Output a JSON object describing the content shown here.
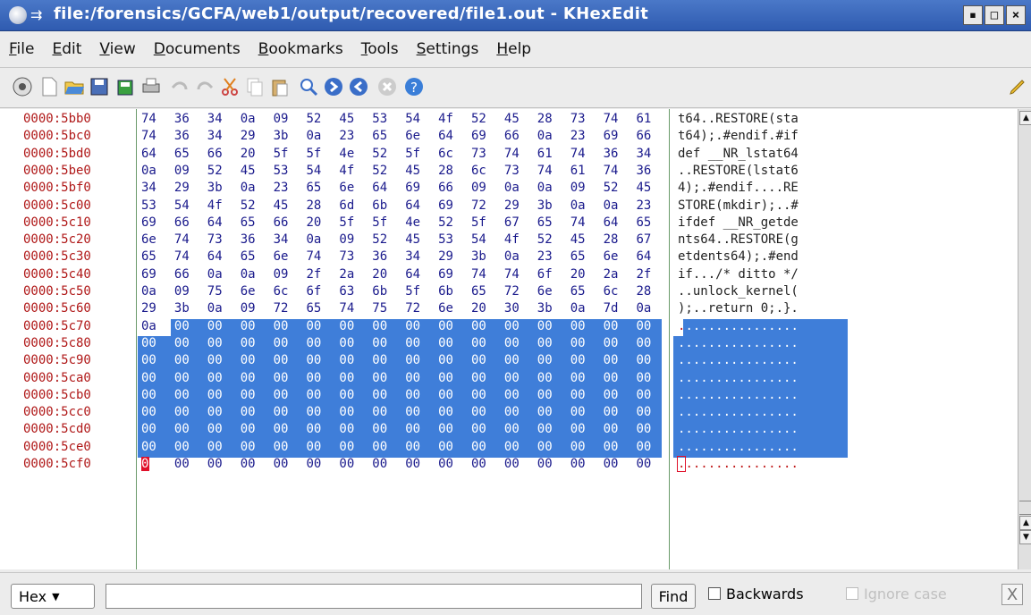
{
  "window": {
    "title": "file:/forensics/GCFA/web1/output/recovered/file1.out - KHexEdit",
    "buttons": [
      "▪",
      "□",
      "×"
    ]
  },
  "menu": [
    {
      "label": "File",
      "ul": "F"
    },
    {
      "label": "Edit",
      "ul": "E"
    },
    {
      "label": "View",
      "ul": "V"
    },
    {
      "label": "Documents",
      "ul": "D"
    },
    {
      "label": "Bookmarks",
      "ul": "B"
    },
    {
      "label": "Tools",
      "ul": "T"
    },
    {
      "label": "Settings",
      "ul": "S"
    },
    {
      "label": "Help",
      "ul": "H"
    }
  ],
  "toolbar_icons": [
    "app-icon",
    "new-file-icon",
    "open-folder-icon",
    "save-icon",
    "save-as-icon",
    "print-icon",
    "undo-icon",
    "redo-icon",
    "cut-icon",
    "copy-icon",
    "paste-icon",
    "find-icon",
    "forward-icon",
    "back-icon",
    "stop-icon",
    "help-icon",
    "edit-pencil-icon"
  ],
  "hex_rows": [
    {
      "offset": "0000:5bb0",
      "bytes": [
        "74",
        "36",
        "34",
        "0a",
        "09",
        "52",
        "45",
        "53",
        "54",
        "4f",
        "52",
        "45",
        "28",
        "73",
        "74",
        "61"
      ],
      "ascii": "t64..RESTORE(sta"
    },
    {
      "offset": "0000:5bc0",
      "bytes": [
        "74",
        "36",
        "34",
        "29",
        "3b",
        "0a",
        "23",
        "65",
        "6e",
        "64",
        "69",
        "66",
        "0a",
        "23",
        "69",
        "66"
      ],
      "ascii": "t64);.#endif.#if"
    },
    {
      "offset": "0000:5bd0",
      "bytes": [
        "64",
        "65",
        "66",
        "20",
        "5f",
        "5f",
        "4e",
        "52",
        "5f",
        "6c",
        "73",
        "74",
        "61",
        "74",
        "36",
        "34"
      ],
      "ascii": "def __NR_lstat64"
    },
    {
      "offset": "0000:5be0",
      "bytes": [
        "0a",
        "09",
        "52",
        "45",
        "53",
        "54",
        "4f",
        "52",
        "45",
        "28",
        "6c",
        "73",
        "74",
        "61",
        "74",
        "36"
      ],
      "ascii": "..RESTORE(lstat6"
    },
    {
      "offset": "0000:5bf0",
      "bytes": [
        "34",
        "29",
        "3b",
        "0a",
        "23",
        "65",
        "6e",
        "64",
        "69",
        "66",
        "09",
        "0a",
        "0a",
        "09",
        "52",
        "45"
      ],
      "ascii": "4);.#endif....RE"
    },
    {
      "offset": "0000:5c00",
      "bytes": [
        "53",
        "54",
        "4f",
        "52",
        "45",
        "28",
        "6d",
        "6b",
        "64",
        "69",
        "72",
        "29",
        "3b",
        "0a",
        "0a",
        "23"
      ],
      "ascii": "STORE(mkdir);..#"
    },
    {
      "offset": "0000:5c10",
      "bytes": [
        "69",
        "66",
        "64",
        "65",
        "66",
        "20",
        "5f",
        "5f",
        "4e",
        "52",
        "5f",
        "67",
        "65",
        "74",
        "64",
        "65"
      ],
      "ascii": "ifdef __NR_getde"
    },
    {
      "offset": "0000:5c20",
      "bytes": [
        "6e",
        "74",
        "73",
        "36",
        "34",
        "0a",
        "09",
        "52",
        "45",
        "53",
        "54",
        "4f",
        "52",
        "45",
        "28",
        "67"
      ],
      "ascii": "nts64..RESTORE(g"
    },
    {
      "offset": "0000:5c30",
      "bytes": [
        "65",
        "74",
        "64",
        "65",
        "6e",
        "74",
        "73",
        "36",
        "34",
        "29",
        "3b",
        "0a",
        "23",
        "65",
        "6e",
        "64"
      ],
      "ascii": "etdents64);.#end"
    },
    {
      "offset": "0000:5c40",
      "bytes": [
        "69",
        "66",
        "0a",
        "0a",
        "09",
        "2f",
        "2a",
        "20",
        "64",
        "69",
        "74",
        "74",
        "6f",
        "20",
        "2a",
        "2f"
      ],
      "ascii": "if.../* ditto */"
    },
    {
      "offset": "0000:5c50",
      "bytes": [
        "0a",
        "09",
        "75",
        "6e",
        "6c",
        "6f",
        "63",
        "6b",
        "5f",
        "6b",
        "65",
        "72",
        "6e",
        "65",
        "6c",
        "28"
      ],
      "ascii": "..unlock_kernel("
    },
    {
      "offset": "0000:5c60",
      "bytes": [
        "29",
        "3b",
        "0a",
        "09",
        "72",
        "65",
        "74",
        "75",
        "72",
        "6e",
        "20",
        "30",
        "3b",
        "0a",
        "7d",
        "0a"
      ],
      "ascii": ");..return 0;.}."
    },
    {
      "offset": "0000:5c70",
      "bytes": [
        "0a",
        "00",
        "00",
        "00",
        "00",
        "00",
        "00",
        "00",
        "00",
        "00",
        "00",
        "00",
        "00",
        "00",
        "00",
        "00"
      ],
      "ascii": "................",
      "sel_from": 1
    },
    {
      "offset": "0000:5c80",
      "bytes": [
        "00",
        "00",
        "00",
        "00",
        "00",
        "00",
        "00",
        "00",
        "00",
        "00",
        "00",
        "00",
        "00",
        "00",
        "00",
        "00"
      ],
      "ascii": "................",
      "sel_from": 0
    },
    {
      "offset": "0000:5c90",
      "bytes": [
        "00",
        "00",
        "00",
        "00",
        "00",
        "00",
        "00",
        "00",
        "00",
        "00",
        "00",
        "00",
        "00",
        "00",
        "00",
        "00"
      ],
      "ascii": "................",
      "sel_from": 0
    },
    {
      "offset": "0000:5ca0",
      "bytes": [
        "00",
        "00",
        "00",
        "00",
        "00",
        "00",
        "00",
        "00",
        "00",
        "00",
        "00",
        "00",
        "00",
        "00",
        "00",
        "00"
      ],
      "ascii": "................",
      "sel_from": 0
    },
    {
      "offset": "0000:5cb0",
      "bytes": [
        "00",
        "00",
        "00",
        "00",
        "00",
        "00",
        "00",
        "00",
        "00",
        "00",
        "00",
        "00",
        "00",
        "00",
        "00",
        "00"
      ],
      "ascii": "................",
      "sel_from": 0
    },
    {
      "offset": "0000:5cc0",
      "bytes": [
        "00",
        "00",
        "00",
        "00",
        "00",
        "00",
        "00",
        "00",
        "00",
        "00",
        "00",
        "00",
        "00",
        "00",
        "00",
        "00"
      ],
      "ascii": "................",
      "sel_from": 0
    },
    {
      "offset": "0000:5cd0",
      "bytes": [
        "00",
        "00",
        "00",
        "00",
        "00",
        "00",
        "00",
        "00",
        "00",
        "00",
        "00",
        "00",
        "00",
        "00",
        "00",
        "00"
      ],
      "ascii": "................",
      "sel_from": 0
    },
    {
      "offset": "0000:5ce0",
      "bytes": [
        "00",
        "00",
        "00",
        "00",
        "00",
        "00",
        "00",
        "00",
        "00",
        "00",
        "00",
        "00",
        "00",
        "00",
        "00",
        "00"
      ],
      "ascii": "................",
      "sel_from": 0
    },
    {
      "offset": "0000:5cf0",
      "bytes": [
        "00",
        "00",
        "00",
        "00",
        "00",
        "00",
        "00",
        "00",
        "00",
        "00",
        "00",
        "00",
        "00",
        "00",
        "00",
        "00"
      ],
      "ascii": "................",
      "cursor": 0
    }
  ],
  "findbar": {
    "mode": "Hex",
    "find_label": "Find",
    "backwards_label": "Backwards",
    "ignore_case_label": "Ignore case",
    "close_symbol": "X"
  },
  "colors": {
    "selection": "#3f7ed9",
    "offset": "#b01818",
    "hex": "#1a1a8c",
    "titlebar": "#3a68be"
  }
}
